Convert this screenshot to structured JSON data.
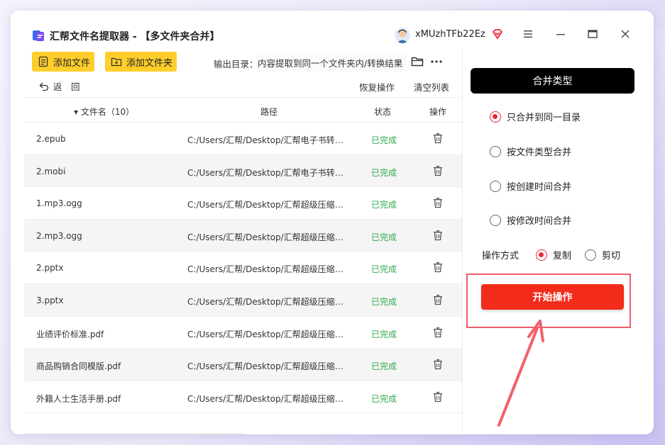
{
  "window": {
    "title": "汇帮文件名提取器 - 【多文件夹合并】",
    "username": "xMUzhTFb22Ez"
  },
  "toolbar": {
    "add_file": "添加文件",
    "add_folder": "添加文件夹",
    "output_label": "输出目录：",
    "output_path": "内容提取到同一个文件夹内/转换结果",
    "back": "返　回",
    "restore": "恢复操作",
    "clear": "清空列表"
  },
  "table": {
    "headers": {
      "name": "▾ 文件名（10）",
      "path": "路径",
      "status": "状态",
      "action": "操作"
    },
    "rows": [
      {
        "name": "2.epub",
        "path": "C:/Users/汇帮/Desktop/汇帮电子书转换...",
        "status": "已完成"
      },
      {
        "name": "2.mobi",
        "path": "C:/Users/汇帮/Desktop/汇帮电子书转换...",
        "status": "已完成"
      },
      {
        "name": "1.mp3.ogg",
        "path": "C:/Users/汇帮/Desktop/汇帮超级压缩器/...",
        "status": "已完成"
      },
      {
        "name": "2.mp3.ogg",
        "path": "C:/Users/汇帮/Desktop/汇帮超级压缩器/...",
        "status": "已完成"
      },
      {
        "name": "2.pptx",
        "path": "C:/Users/汇帮/Desktop/汇帮超级压缩器/...",
        "status": "已完成"
      },
      {
        "name": "3.pptx",
        "path": "C:/Users/汇帮/Desktop/汇帮超级压缩器/...",
        "status": "已完成"
      },
      {
        "name": "业绩评价标准.pdf",
        "path": "C:/Users/汇帮/Desktop/汇帮超级压缩器/...",
        "status": "已完成"
      },
      {
        "name": "商品购销合同模版.pdf",
        "path": "C:/Users/汇帮/Desktop/汇帮超级压缩器/...",
        "status": "已完成"
      },
      {
        "name": "外籍人士生活手册.pdf",
        "path": "C:/Users/汇帮/Desktop/汇帮超级压缩器/...",
        "status": "已完成"
      }
    ]
  },
  "panel": {
    "merge_title": "合并类型",
    "merge_options": [
      {
        "label": "只合并到同一目录",
        "selected": true
      },
      {
        "label": "按文件类型合并",
        "selected": false
      },
      {
        "label": "按创建时间合并",
        "selected": false
      },
      {
        "label": "按修改时间合并",
        "selected": false
      }
    ],
    "operation_label": "操作方式",
    "operation_options": [
      {
        "label": "复制",
        "selected": true
      },
      {
        "label": "剪切",
        "selected": false
      }
    ],
    "start_button": "开始操作"
  },
  "colors": {
    "accent_yellow": "#ffce2b",
    "accent_red": "#f22b1a",
    "status_green": "#2fa84f",
    "radio_red": "#e8273d"
  },
  "icons": [
    "app-logo-icon",
    "vip-icon",
    "menu-icon",
    "minimize-icon",
    "maximize-icon",
    "close-icon",
    "add-file-icon",
    "add-folder-icon",
    "folder-icon",
    "more-icon",
    "back-icon",
    "trash-icon",
    "arrow-icon"
  ]
}
